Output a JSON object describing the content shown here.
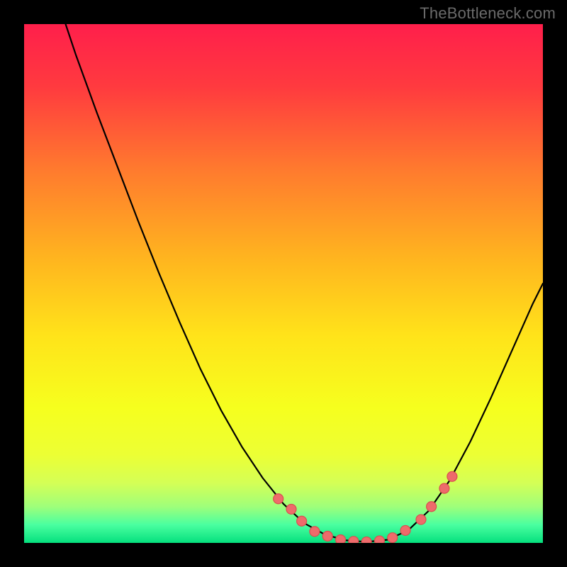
{
  "attribution": "TheBottleneck.com",
  "chart_data": {
    "type": "line",
    "title": "",
    "xlabel": "",
    "ylabel": "",
    "xlim": [
      0,
      100
    ],
    "ylim": [
      0,
      100
    ],
    "grid": false,
    "legend": false,
    "gradient_stops": [
      {
        "offset": 0.0,
        "color": "#ff1f4b"
      },
      {
        "offset": 0.12,
        "color": "#ff3a3f"
      },
      {
        "offset": 0.28,
        "color": "#ff7a2e"
      },
      {
        "offset": 0.45,
        "color": "#ffb41f"
      },
      {
        "offset": 0.6,
        "color": "#ffe31a"
      },
      {
        "offset": 0.74,
        "color": "#f6ff1e"
      },
      {
        "offset": 0.83,
        "color": "#ecff34"
      },
      {
        "offset": 0.885,
        "color": "#d4ff56"
      },
      {
        "offset": 0.93,
        "color": "#9fff7a"
      },
      {
        "offset": 0.965,
        "color": "#4affa0"
      },
      {
        "offset": 1.0,
        "color": "#05e07e"
      }
    ],
    "series": [
      {
        "name": "bottleneck-curve",
        "color": "#000000",
        "width": 2.2,
        "points": [
          {
            "x": 8.0,
            "y": 100.0
          },
          {
            "x": 10.0,
            "y": 94.0
          },
          {
            "x": 14.0,
            "y": 83.0
          },
          {
            "x": 18.0,
            "y": 72.5
          },
          {
            "x": 22.0,
            "y": 62.0
          },
          {
            "x": 26.0,
            "y": 52.0
          },
          {
            "x": 30.0,
            "y": 42.5
          },
          {
            "x": 34.0,
            "y": 33.5
          },
          {
            "x": 38.0,
            "y": 25.5
          },
          {
            "x": 42.0,
            "y": 18.5
          },
          {
            "x": 46.0,
            "y": 12.5
          },
          {
            "x": 50.0,
            "y": 7.5
          },
          {
            "x": 54.0,
            "y": 3.8
          },
          {
            "x": 58.0,
            "y": 1.6
          },
          {
            "x": 62.0,
            "y": 0.5
          },
          {
            "x": 66.0,
            "y": 0.2
          },
          {
            "x": 70.0,
            "y": 0.6
          },
          {
            "x": 74.0,
            "y": 2.4
          },
          {
            "x": 78.0,
            "y": 6.2
          },
          {
            "x": 82.0,
            "y": 12.0
          },
          {
            "x": 86.0,
            "y": 19.5
          },
          {
            "x": 90.0,
            "y": 28.0
          },
          {
            "x": 94.0,
            "y": 37.0
          },
          {
            "x": 98.0,
            "y": 46.0
          },
          {
            "x": 100.0,
            "y": 50.0
          }
        ]
      }
    ],
    "markers": {
      "color": "#ee6b6b",
      "stroke": "#d94f4f",
      "radius": 7,
      "points": [
        {
          "x": 49.0,
          "y": 8.5
        },
        {
          "x": 51.5,
          "y": 6.5
        },
        {
          "x": 53.5,
          "y": 4.2
        },
        {
          "x": 56.0,
          "y": 2.2
        },
        {
          "x": 58.5,
          "y": 1.3
        },
        {
          "x": 61.0,
          "y": 0.6
        },
        {
          "x": 63.5,
          "y": 0.3
        },
        {
          "x": 66.0,
          "y": 0.2
        },
        {
          "x": 68.5,
          "y": 0.4
        },
        {
          "x": 71.0,
          "y": 1.0
        },
        {
          "x": 73.5,
          "y": 2.4
        },
        {
          "x": 76.5,
          "y": 4.5
        },
        {
          "x": 78.5,
          "y": 7.0
        },
        {
          "x": 81.0,
          "y": 10.5
        },
        {
          "x": 82.5,
          "y": 12.8
        }
      ]
    }
  }
}
